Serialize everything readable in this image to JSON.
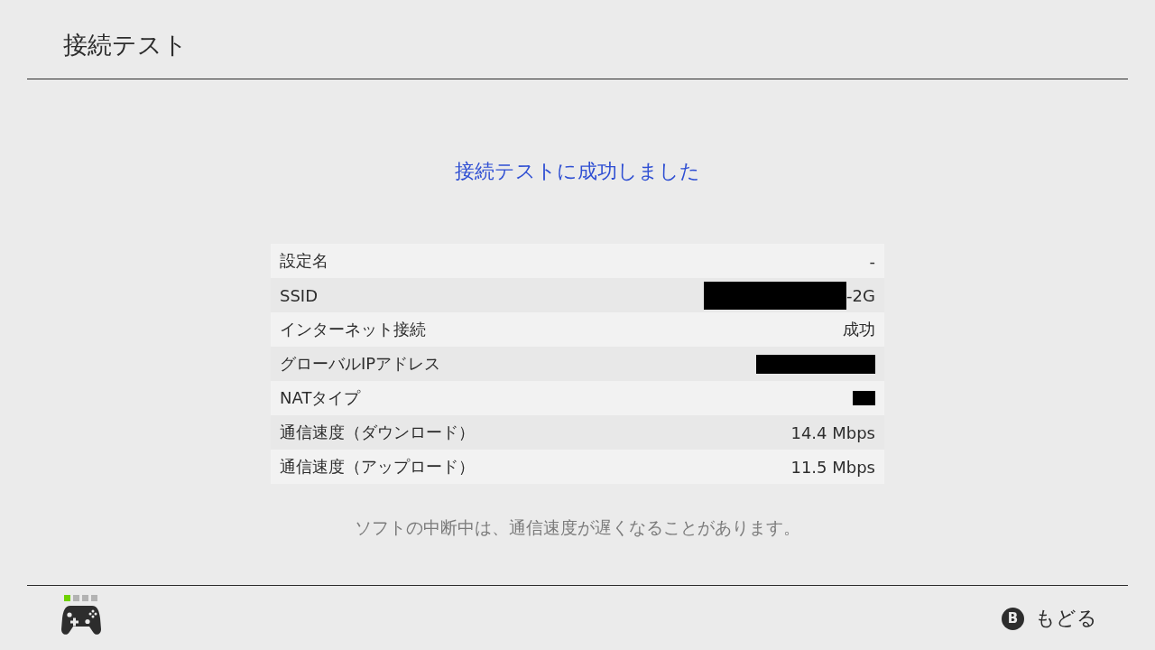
{
  "header": {
    "title": "接続テスト"
  },
  "result": {
    "message": "接続テストに成功しました",
    "rows": [
      {
        "label": "設定名",
        "value": "-",
        "redacted": false
      },
      {
        "label": "SSID",
        "value": "-2G",
        "redacted": true
      },
      {
        "label": "インターネット接続",
        "value": "成功",
        "redacted": false
      },
      {
        "label": "グローバルIPアドレス",
        "redacted": true
      },
      {
        "label": "NATタイプ",
        "redacted": true
      },
      {
        "label": "通信速度（ダウンロード）",
        "value": "14.4 Mbps",
        "redacted": false
      },
      {
        "label": "通信速度（アップロード）",
        "value": "11.5 Mbps",
        "redacted": false
      }
    ],
    "note": "ソフトの中断中は、通信速度が遅くなることがあります。"
  },
  "footer": {
    "players": [
      {
        "on": true
      },
      {
        "on": false
      },
      {
        "on": false
      },
      {
        "on": false
      }
    ],
    "back_button": {
      "key": "B",
      "label": "もどる"
    }
  }
}
